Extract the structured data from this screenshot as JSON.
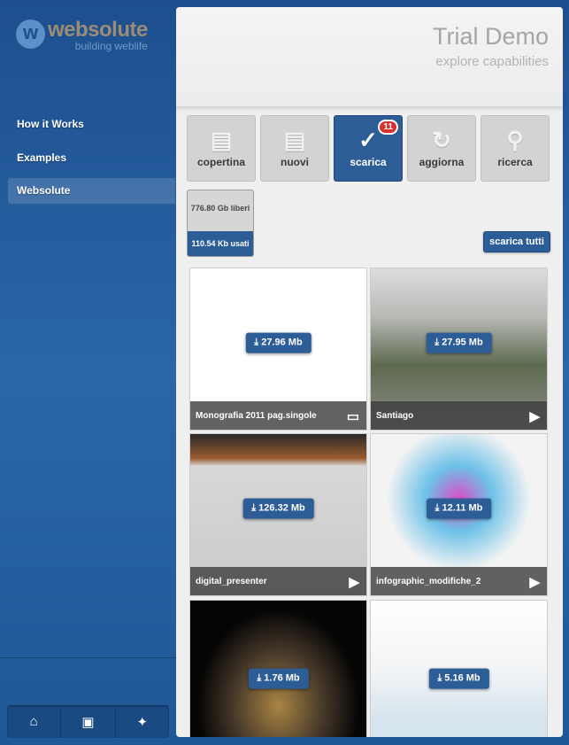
{
  "sidebar": {
    "logo": {
      "mark": "w",
      "name": "websolute",
      "tagline": "building weblife"
    },
    "items": [
      {
        "label": "How it Works"
      },
      {
        "label": "Examples"
      },
      {
        "label": "Websolute",
        "active": true
      }
    ],
    "bottom_icons": [
      "home-icon",
      "contact-card-icon",
      "plug-icon"
    ]
  },
  "header": {
    "title": "Trial Demo",
    "subtitle": "explore capabilities"
  },
  "toolbar": [
    {
      "label": "copertina",
      "icon": "cover-icon"
    },
    {
      "label": "nuovi",
      "icon": "document-icon"
    },
    {
      "label": "scarica",
      "icon": "checkmark-icon",
      "active": true,
      "badge": "11"
    },
    {
      "label": "aggiorna",
      "icon": "refresh-icon"
    },
    {
      "label": "ricerca",
      "icon": "search-icon"
    }
  ],
  "storage": {
    "free": "776.80 Gb liberi",
    "used": "110.54 Kb usati"
  },
  "download_all": "scarica tutti",
  "items": [
    {
      "size": "27.96 Mb",
      "title": "Monografia 2011 pag.singole",
      "type": "document"
    },
    {
      "size": "27.95 Mb",
      "title": "Santiago",
      "type": "video"
    },
    {
      "size": "126.32 Mb",
      "title": "digital_presenter",
      "type": "video"
    },
    {
      "size": "12.11 Mb",
      "title": "infographic_modifiche_2",
      "type": "video"
    },
    {
      "size": "1.76 Mb",
      "title": "",
      "type": ""
    },
    {
      "size": "5.16 Mb",
      "title": "",
      "type": ""
    }
  ],
  "colors": {
    "accent": "#2c5d97",
    "badge": "#d8322f",
    "sidebar": "#2a66a8"
  }
}
